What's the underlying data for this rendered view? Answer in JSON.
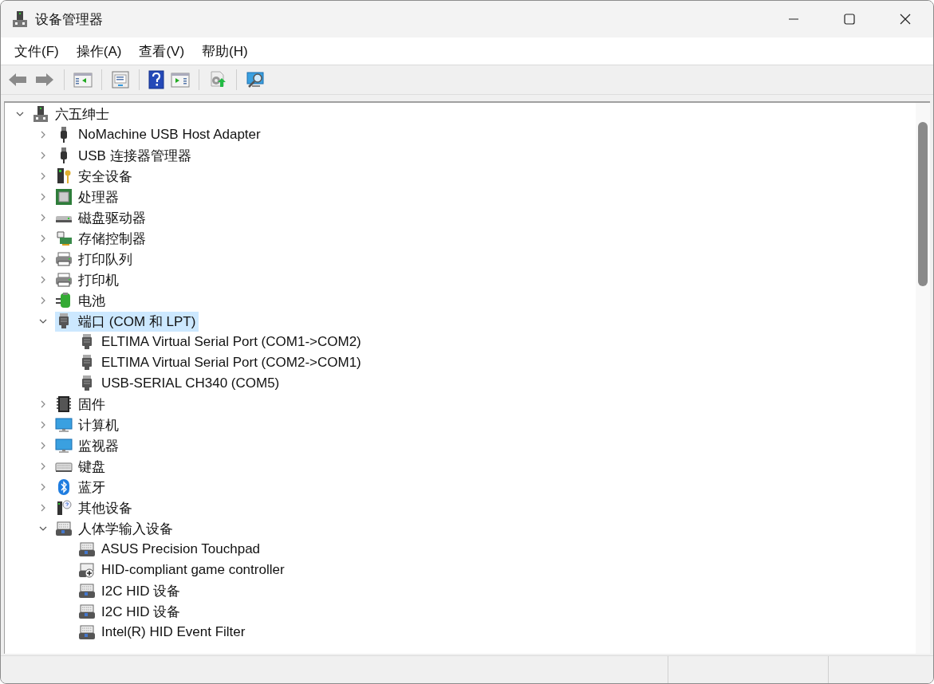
{
  "window": {
    "title": "设备管理器"
  },
  "menu": [
    "文件(F)",
    "操作(A)",
    "查看(V)",
    "帮助(H)"
  ],
  "tree": {
    "label": "六五绅士",
    "kind": "computer",
    "expanded": true,
    "selected": false,
    "children": [
      {
        "label": "NoMachine USB Host Adapter",
        "kind": "usb",
        "expanded": false,
        "selected": false
      },
      {
        "label": "USB 连接器管理器",
        "kind": "usb",
        "expanded": false,
        "selected": false
      },
      {
        "label": "安全设备",
        "kind": "security",
        "expanded": false,
        "selected": false
      },
      {
        "label": "处理器",
        "kind": "cpu",
        "expanded": false,
        "selected": false
      },
      {
        "label": "磁盘驱动器",
        "kind": "disk",
        "expanded": false,
        "selected": false
      },
      {
        "label": "存储控制器",
        "kind": "storage",
        "expanded": false,
        "selected": false
      },
      {
        "label": "打印队列",
        "kind": "printer",
        "expanded": false,
        "selected": false
      },
      {
        "label": "打印机",
        "kind": "printer",
        "expanded": false,
        "selected": false
      },
      {
        "label": "电池",
        "kind": "battery",
        "expanded": false,
        "selected": false
      },
      {
        "label": "端口 (COM 和 LPT)",
        "kind": "port",
        "expanded": true,
        "selected": true,
        "children": [
          {
            "label": "ELTIMA Virtual Serial Port (COM1->COM2)",
            "kind": "port",
            "selected": false
          },
          {
            "label": "ELTIMA Virtual Serial Port (COM2->COM1)",
            "kind": "port",
            "selected": false
          },
          {
            "label": "USB-SERIAL CH340 (COM5)",
            "kind": "port",
            "selected": false
          }
        ]
      },
      {
        "label": "固件",
        "kind": "firmware",
        "expanded": false,
        "selected": false
      },
      {
        "label": "计算机",
        "kind": "monitor",
        "expanded": false,
        "selected": false
      },
      {
        "label": "监视器",
        "kind": "monitor",
        "expanded": false,
        "selected": false
      },
      {
        "label": "键盘",
        "kind": "keyboard",
        "expanded": false,
        "selected": false
      },
      {
        "label": "蓝牙",
        "kind": "bluetooth",
        "expanded": false,
        "selected": false
      },
      {
        "label": "其他设备",
        "kind": "other",
        "expanded": false,
        "selected": false
      },
      {
        "label": "人体学输入设备",
        "kind": "hid",
        "expanded": true,
        "selected": false,
        "children": [
          {
            "label": "ASUS Precision Touchpad",
            "kind": "hid",
            "selected": false
          },
          {
            "label": "HID-compliant game controller",
            "kind": "gamepad",
            "selected": false
          },
          {
            "label": "I2C HID 设备",
            "kind": "hid",
            "selected": false
          },
          {
            "label": "I2C HID 设备",
            "kind": "hid",
            "selected": false
          },
          {
            "label": "Intel(R) HID Event Filter",
            "kind": "hid",
            "selected": false
          }
        ]
      }
    ]
  }
}
